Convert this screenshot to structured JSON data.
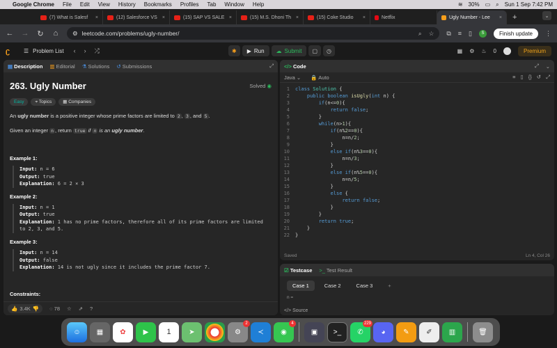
{
  "menubar": {
    "app": "Google Chrome",
    "items": [
      "File",
      "Edit",
      "View",
      "History",
      "Bookmarks",
      "Profiles",
      "Tab",
      "Window",
      "Help"
    ],
    "battery": "30%",
    "datetime": "Sun 1 Sep  7:42 PM"
  },
  "tabs": [
    {
      "label": "(7) What is Salesf"
    },
    {
      "label": "(12) Salesforce VS"
    },
    {
      "label": "(15) SAP VS SALE"
    },
    {
      "label": "(15) M.S. Dhoni Th"
    },
    {
      "label": "(15) Coke Studio"
    },
    {
      "label": "Netflix"
    },
    {
      "label": "Ugly Number - Lee"
    }
  ],
  "address": {
    "url": "leetcode.com/problems/ugly-number/",
    "finish": "Finish update",
    "avatar": "S"
  },
  "lc": {
    "problem_list": "Problem List",
    "run": "Run",
    "submit": "Submit",
    "streak": "0",
    "premium": "Premium"
  },
  "left_tabs": [
    "Description",
    "Editorial",
    "Solutions",
    "Submissions"
  ],
  "problem": {
    "title": "263. Ugly Number",
    "solved": "Solved",
    "tags": [
      "Easy",
      "Topics",
      "Companies"
    ],
    "p1_a": "An ",
    "p1_b": "ugly number",
    "p1_c": " is a positive integer whose prime factors are limited to ",
    "p1_d": "2",
    "p1_e": ", ",
    "p1_f": "3",
    "p1_g": ", and ",
    "p1_h": "5",
    "p1_i": ".",
    "p2_a": "Given an integer ",
    "p2_b": "n",
    "p2_c": ", return ",
    "p2_d": "true",
    "p2_e": " if ",
    "p2_f": "n",
    "p2_g": " is an ",
    "p2_h": "ugly number",
    "p2_i": ".",
    "examples": [
      {
        "title": "Example 1:",
        "input": "n = 6",
        "output": "true",
        "explanation": "6 = 2 × 3"
      },
      {
        "title": "Example 2:",
        "input": "n = 1",
        "output": "true",
        "explanation": "1 has no prime factors, therefore all of its prime factors are limited to 2, 3, and 5."
      },
      {
        "title": "Example 3:",
        "input": "n = 14",
        "output": "false",
        "explanation": "14 is not ugly since it includes the prime factor 7."
      }
    ],
    "input_lbl": "Input:",
    "output_lbl": "Output:",
    "expl_lbl": "Explanation:",
    "constraints": "Constraints:",
    "likes": "3.4K",
    "comments": "78"
  },
  "code_panel": {
    "title": "Code",
    "lang": "Java",
    "auto": "Auto",
    "saved": "Saved",
    "pos": "Ln 4, Col 26"
  },
  "testcase": {
    "title": "Testcase",
    "result": "Test Result",
    "cases": [
      "Case 1",
      "Case 2",
      "Case 3"
    ],
    "n_label": "n =",
    "source": "Source"
  },
  "dock_badges": {
    "settings": "2",
    "messages": "4",
    "whatsapp": "229"
  }
}
